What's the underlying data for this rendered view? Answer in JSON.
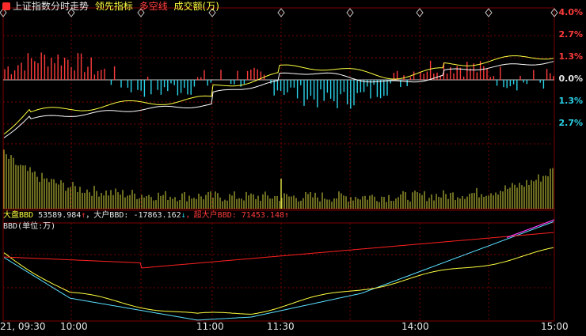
{
  "header": {
    "title": "上证指数分时走势",
    "indicator1": "领先指标",
    "indicator2": "多空线",
    "indicator3": "成交额(万)"
  },
  "right_axis": {
    "up": [
      "4.0%",
      "2.7%",
      "1.3%"
    ],
    "zero": "0.0%",
    "down": [
      "1.3%",
      "2.7%"
    ]
  },
  "bbd": {
    "label1": "大盘BBD",
    "value1": "53589.984",
    "arrow1": "↑",
    "label2": "，大户BBD:",
    "value2": "-17863.162",
    "arrow2": "↓",
    "label3": "，超大户BBD:",
    "value3": "71453.148",
    "arrow3": "↑",
    "unit": "BBD(单位:万)"
  },
  "time_axis": [
    "21, 09:30",
    "10:00",
    "11:00",
    "11:30",
    "14:00",
    "15:00"
  ],
  "colors": {
    "up": "#ff3b3b",
    "down": "#2ad3e8",
    "white_line": "#ffffff",
    "yellow_line": "#ffff40",
    "volume": "#d8d840",
    "bbd_main": "#5ae0ff",
    "bbd_big": "#ffff40",
    "bbd_super": "#ff2020",
    "bbd_highlight": "#ff40ff",
    "grid": "#7a0000"
  }
}
